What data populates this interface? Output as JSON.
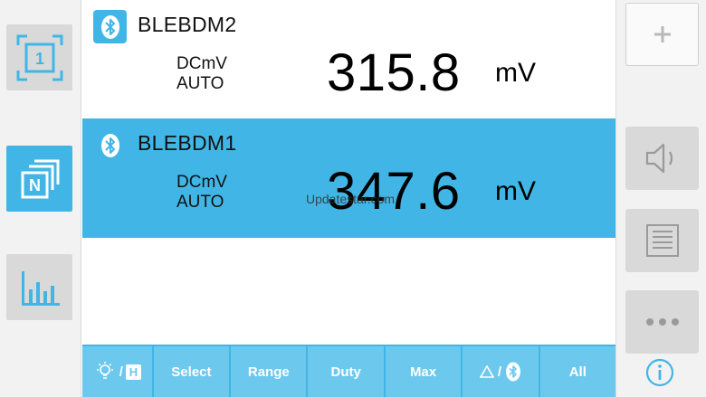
{
  "meters": [
    {
      "device": "BLEBDM2",
      "mode": "DCmV",
      "range": "AUTO",
      "value": "315.8",
      "unit": "mV",
      "selected": false
    },
    {
      "device": "BLEBDM1",
      "mode": "DCmV",
      "range": "AUTO",
      "value": "347.6",
      "unit": "mV",
      "selected": true
    }
  ],
  "watermark": "Updatestar.com",
  "left_sidebar": {
    "buttons": [
      {
        "icon": "single-meter-icon",
        "label": "1"
      },
      {
        "icon": "multi-meter-icon",
        "label": "N"
      },
      {
        "icon": "bar-chart-icon"
      }
    ]
  },
  "right_sidebar": {
    "buttons": [
      {
        "icon": "plus-icon"
      },
      {
        "icon": "speaker-icon"
      },
      {
        "icon": "list-icon"
      },
      {
        "icon": "more-icon"
      },
      {
        "icon": "info-icon"
      }
    ]
  },
  "toolbar": {
    "light_hold_label": "/",
    "hold_letter": "H",
    "select_label": "Select",
    "range_label": "Range",
    "duty_label": "Duty",
    "max_label": "Max",
    "delta_bt_label": "/",
    "all_label": "All"
  },
  "colors": {
    "accent": "#41b6e6",
    "toolbar_button": "#6dc8ee",
    "sidebar_bg": "#f2f2f2",
    "sidebar_button": "#d9d9d9"
  }
}
